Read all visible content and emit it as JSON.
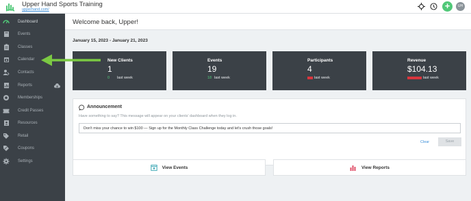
{
  "header": {
    "title": "Upper Hand Sports Training",
    "url": "upperhand.com/",
    "icons": [
      "crosshair-icon",
      "clock-icon",
      "plus-icon"
    ],
    "avatar_initials": "UH",
    "accent": "#50c878"
  },
  "sidebar": {
    "items": [
      {
        "label": "Dashboard",
        "icon": "dashboard-icon"
      },
      {
        "label": "Events",
        "icon": "book-icon"
      },
      {
        "label": "Classes",
        "icon": "clipboard-icon"
      },
      {
        "label": "Calendar",
        "icon": "calendar-icon"
      },
      {
        "label": "Contacts",
        "icon": "contacts-icon"
      },
      {
        "label": "Reports",
        "icon": "reports-icon"
      },
      {
        "label": "Memberships",
        "icon": "membership-icon"
      },
      {
        "label": "Credit Passes",
        "icon": "ticket-icon"
      },
      {
        "label": "Resources",
        "icon": "resources-icon"
      },
      {
        "label": "Retail",
        "icon": "tag-icon"
      },
      {
        "label": "Coupons",
        "icon": "coupon-icon"
      },
      {
        "label": "Settings",
        "icon": "gear-icon"
      }
    ]
  },
  "main": {
    "welcome": "Welcome back, Upper!",
    "date_range": "January 15, 2023 - January 21, 2023",
    "stats": [
      {
        "title": "New Clients",
        "value": "1",
        "delta": "0",
        "delta_color": "#50c878",
        "sub": "last week"
      },
      {
        "title": "Events",
        "value": "19",
        "delta": "18",
        "delta_color": "#50c878",
        "sub": "last week"
      },
      {
        "title": "Participants",
        "value": "4",
        "delta": "",
        "delta_color": "#d9363e",
        "sub": "last week"
      },
      {
        "title": "Revenue",
        "value": "$104.13",
        "delta": "",
        "delta_color": "#d9363e",
        "sub": "last week"
      }
    ],
    "announcement": {
      "title": "Announcement",
      "hint": "Have something to say? This message will appear on your clients' dashboard when they log in.",
      "value": "Don't miss your chance to win $100 — Sign up for the Monthly Class Challenge today and let's crush those goals!",
      "clear_label": "Clear",
      "save_label": "Save"
    },
    "buttons": {
      "view_events": "View Events",
      "view_reports": "View Reports"
    }
  }
}
